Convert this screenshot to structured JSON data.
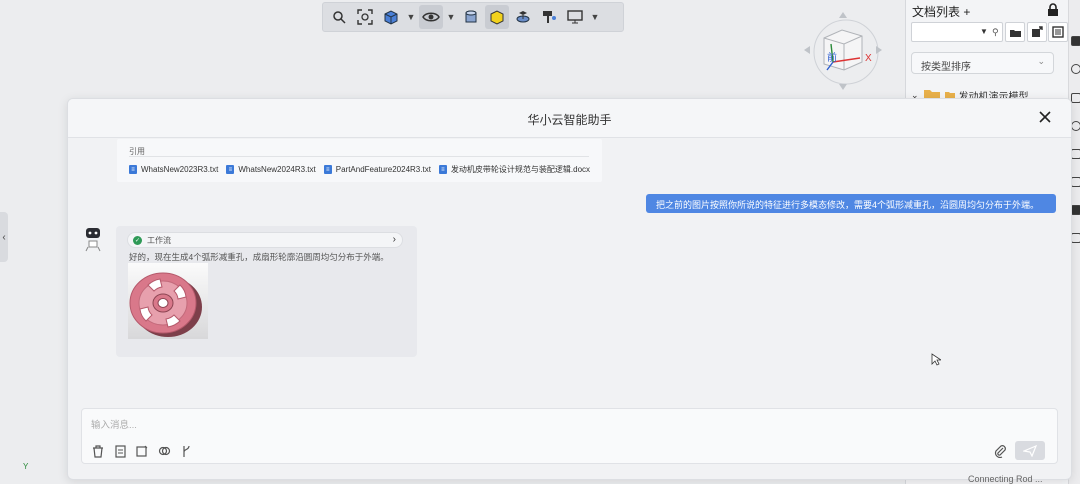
{
  "toolbar": {
    "buttons": [
      "zoom-icon",
      "zoom-fit-icon",
      "view-cube-icon",
      "eye-icon",
      "cylinder-icon",
      "shaded-icon",
      "section-icon",
      "paint-icon",
      "display-icon"
    ]
  },
  "viewcube": {
    "face_label": "前",
    "x_axis": "X"
  },
  "doc_panel": {
    "title": "文档列表 +",
    "sort_label": "按类型排序",
    "tree_item": "发动机演示模型"
  },
  "dialog": {
    "title": "华小云智能助手",
    "quote": {
      "label": "引用",
      "files": [
        "WhatsNew2023R3.txt",
        "WhatsNew2024R3.txt",
        "PartAndFeature2024R3.txt",
        "发动机皮带轮设计规范与装配逻辑.docx"
      ]
    },
    "user_message": "把之前的图片按照你所说的特征进行多模态修改，需要4个弧形减重孔，沿圆周均匀分布于外端。",
    "bot": {
      "workflow_label": "工作流",
      "reply": "好的，现在生成4个弧形减重孔，成扇形轮廓沿圆周均匀分布于外端。"
    },
    "input": {
      "placeholder": "输入消息..."
    }
  },
  "status": {
    "bottom_text": "Connecting Rod ...",
    "axis_label": "Y"
  },
  "colors": {
    "accent": "#4f87e3",
    "success": "#2f9a57",
    "pulley": "#d9788a"
  }
}
